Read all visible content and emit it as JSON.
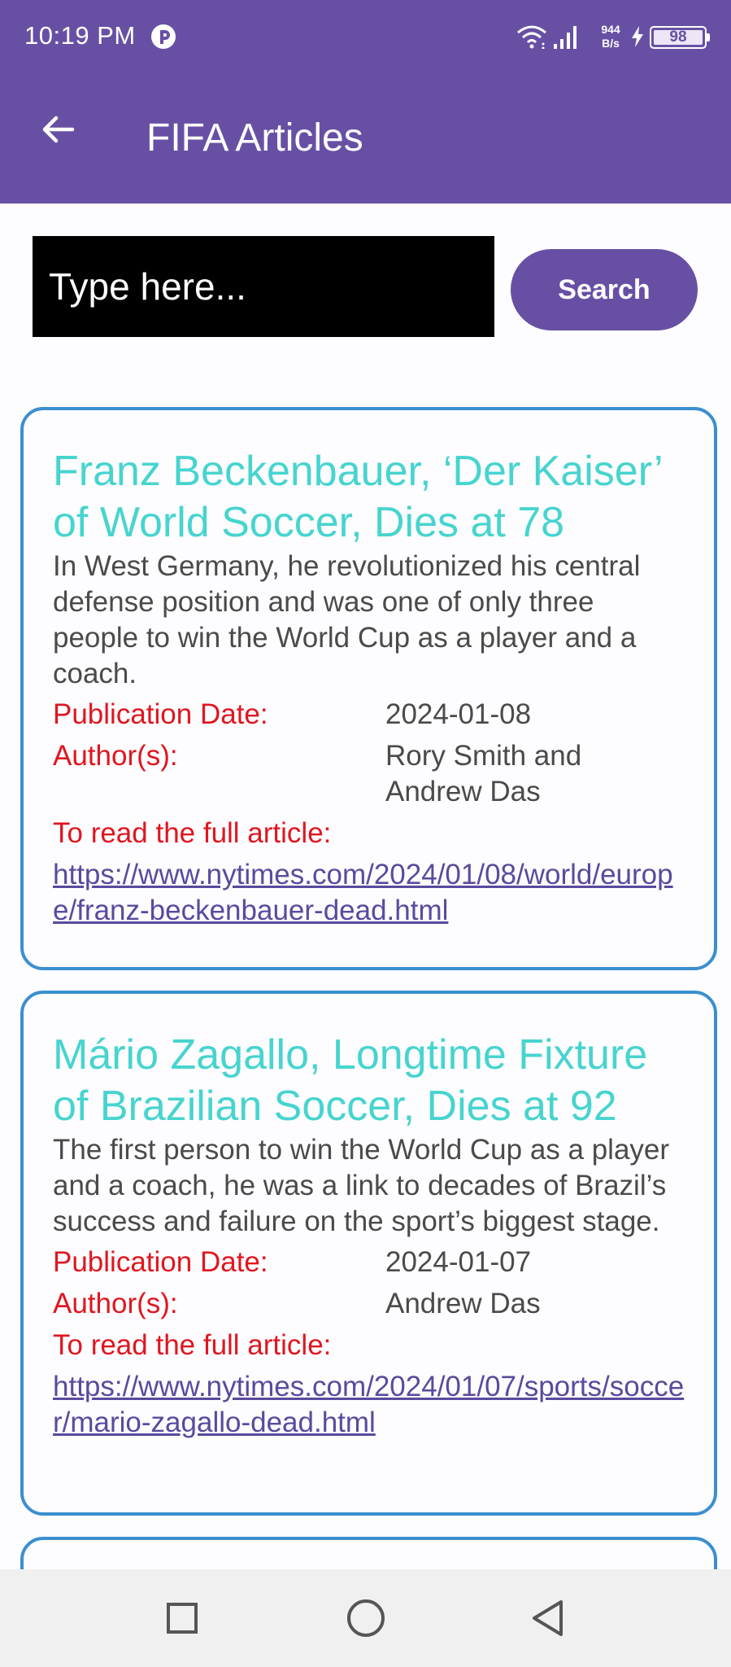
{
  "status_bar": {
    "time": "10:19 PM",
    "net_speed_value": "944",
    "net_speed_unit": "B/s",
    "battery": "98",
    "icons": [
      "app-notification-icon",
      "wifi-icon",
      "signal-icon",
      "charging-icon",
      "battery-icon"
    ]
  },
  "app_bar": {
    "title": "FIFA Articles",
    "back_icon": "arrow-left-icon"
  },
  "search": {
    "placeholder": "Type here...",
    "button_label": "Search"
  },
  "labels": {
    "publication_date": "Publication Date:",
    "authors": "Author(s):",
    "read_full": "To read the full article:"
  },
  "articles": [
    {
      "title": "Franz Beckenbauer, ‘Der Kaiser’ of World Soccer, Dies at 78",
      "summary": "In West Germany, he revolutionized his central defense position and was one of only three people to win the World Cup as a player and a coach.",
      "publication_date": "2024-01-08",
      "authors": "Rory Smith and Andrew Das",
      "url": "https://www.nytimes.com/2024/01/08/world/europe/franz-beckenbauer-dead.html"
    },
    {
      "title": "Mário Zagallo, Longtime Fixture of Brazilian Soccer, Dies at 92",
      "summary": "The first person to win the World Cup as a player and a coach, he was a link to decades of Brazil’s success and failure on the sport’s biggest stage.",
      "publication_date": "2024-01-07",
      "authors": "Andrew Das",
      "url": "https://www.nytimes.com/2024/01/07/sports/soccer/mario-zagallo-dead.html"
    }
  ],
  "colors": {
    "primary": "#6750a4",
    "title_teal": "#47d4cf",
    "label_red": "#e0161f",
    "card_border": "#3b8fd0",
    "link": "#5a4a9e"
  },
  "nav_bar": {
    "icons": [
      "recents-square-icon",
      "home-circle-icon",
      "back-triangle-icon"
    ]
  }
}
